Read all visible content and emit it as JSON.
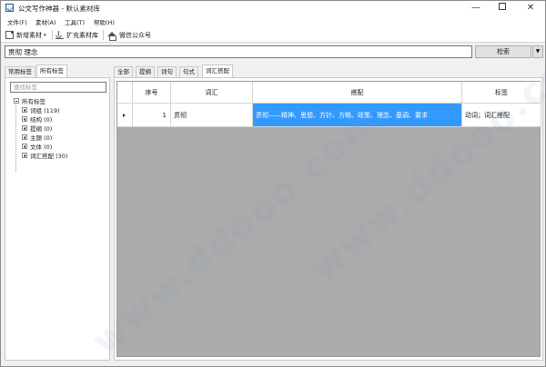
{
  "window": {
    "title": "公文写作神器  -  默认素材库",
    "minimize_glyph": "—",
    "close_glyph": "✕"
  },
  "menu": [
    {
      "label": "文件(F)"
    },
    {
      "label": "素材(A)"
    },
    {
      "label": "工具(T)"
    },
    {
      "label": "帮助(H)"
    }
  ],
  "toolbar": {
    "new_material": "新增素材",
    "expand_library": "扩充素材库",
    "wechat_account": "微信公众号",
    "caret": "▾"
  },
  "search": {
    "value": "贯彻 理念",
    "button_label": "检索",
    "dropdown_glyph": "▼"
  },
  "left_tabs": [
    {
      "label": "常用标签",
      "active": false
    },
    {
      "label": "所有标签",
      "active": true
    }
  ],
  "tag_filter": {
    "placeholder": "查找标签"
  },
  "tree": {
    "root": "所有标签",
    "children": [
      {
        "label": "词组 (119)"
      },
      {
        "label": "结构 (0)"
      },
      {
        "label": "提纲 (0)"
      },
      {
        "label": "主题 (0)"
      },
      {
        "label": "文体 (0)"
      },
      {
        "label": "词汇搭配 (30)"
      }
    ]
  },
  "right_tabs": [
    {
      "label": "全部",
      "active": false
    },
    {
      "label": "提纲",
      "active": false
    },
    {
      "label": "词句",
      "active": false
    },
    {
      "label": "句式",
      "active": false
    },
    {
      "label": "词汇搭配",
      "active": true
    }
  ],
  "grid": {
    "columns": [
      "序号",
      "词汇",
      "搭配",
      "标签"
    ],
    "rows": [
      {
        "index": "1",
        "word": "贯彻",
        "collocation": "贯彻——精神、思想、方针、方略、政策、理念、基调、要求",
        "tags": "动词；词汇搭配",
        "selected_cell": "collocation"
      }
    ]
  },
  "watermark": {
    "text": "www.ddooo.com"
  }
}
